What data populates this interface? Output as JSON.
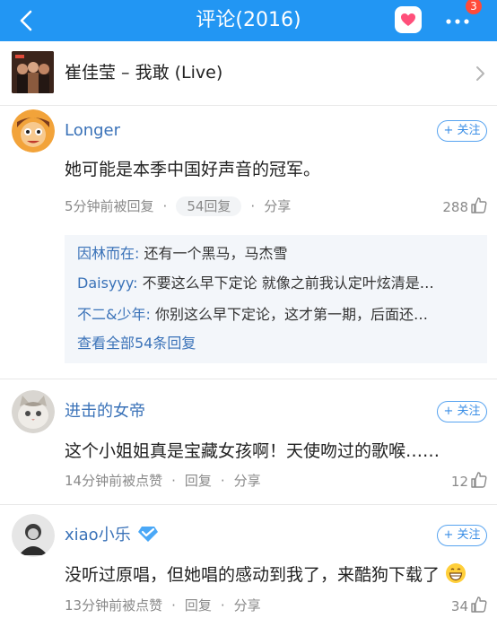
{
  "header": {
    "title": "评论(2016)",
    "badge_count": "3",
    "accent_color": "#2296f3"
  },
  "song": {
    "title": "崔佳莹 – 我敢 (Live)"
  },
  "comments": [
    {
      "username": "Longer",
      "follow_label": "+ 关注",
      "text": "她可能是本季中国好声音的冠军。",
      "time": "5分钟前被回复",
      "reply_label": "54回复",
      "share_label": "分享",
      "likes": "288",
      "replies": [
        {
          "name": "因林而在:",
          "text": "还有一个黑马，马杰雪"
        },
        {
          "name": "Daisyyy:",
          "text": "不要这么早下定论 就像之前我认定叶炫清是…"
        },
        {
          "name": "不二&少年:",
          "text": "你别这么早下定论，这才第一期，后面还…"
        }
      ],
      "view_all": "查看全部54条回复"
    },
    {
      "username": "进击的女帝",
      "follow_label": "+ 关注",
      "text": "这个小姐姐真是宝藏女孩啊！天使吻过的歌喉……",
      "time": "14分钟前被点赞",
      "reply_label": "回复",
      "share_label": "分享",
      "likes": "12"
    },
    {
      "username": "xiao小乐",
      "follow_label": "+ 关注",
      "text": "没听过原唱，但她唱的感动到我了，来酷狗下载了",
      "time": "13分钟前被点赞",
      "reply_label": "回复",
      "share_label": "分享",
      "likes": "34"
    }
  ]
}
